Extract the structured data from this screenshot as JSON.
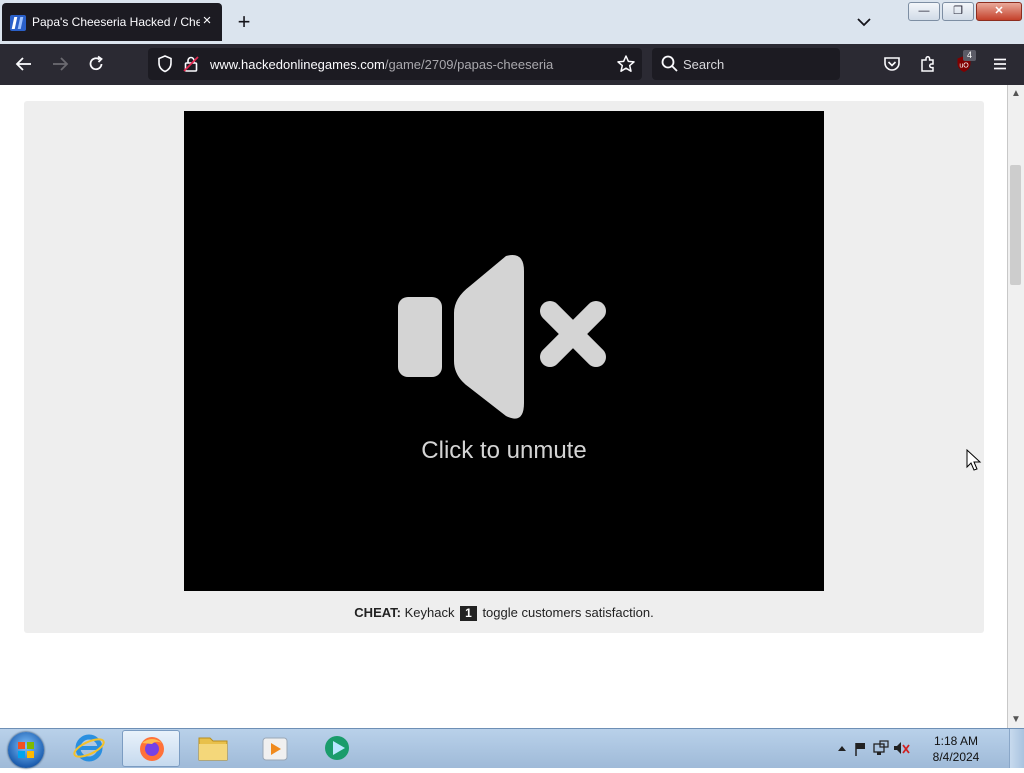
{
  "browser": {
    "tab_title": "Papa's Cheeseria Hacked / Che",
    "tab_close": "×",
    "new_tab": "+",
    "url_domain": "www.hackedonlinegames.com",
    "url_path": "/game/2709/papas-cheeseria",
    "search_placeholder": "Search",
    "extension_badge": "4"
  },
  "window": {
    "minimize": "—",
    "maximize": "❐",
    "close": "✕"
  },
  "game": {
    "unmute_label": "Click to unmute",
    "cheat_prefix": "CHEAT:",
    "cheat_text_before": "Keyhack",
    "cheat_key": "1",
    "cheat_text_after": "toggle customers satisfaction."
  },
  "taskbar": {
    "time": "1:18 AM",
    "date": "8/4/2024"
  },
  "colors": {
    "toolbar": "#2b2a33",
    "tab_active": "#1c1b22",
    "game_bg": "#000000",
    "mute_icon": "#d4d4d4",
    "taskbar": "#b9d1ea"
  }
}
